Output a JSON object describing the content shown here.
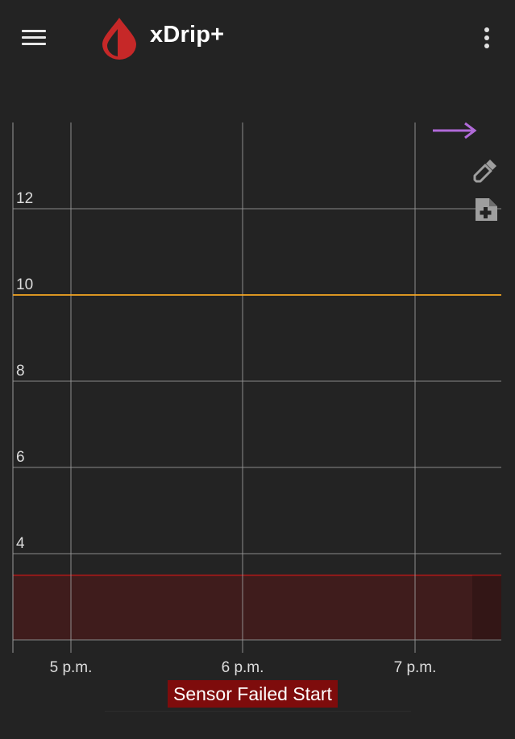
{
  "app": {
    "title": "xDrip+",
    "logo_icon": "droplet-logo-icon",
    "brand_color": "#c62828"
  },
  "toolbar": {
    "menu_icon": "hamburger-menu-icon",
    "overflow_icon": "more-vert-icon"
  },
  "side_actions": [
    {
      "icon": "arrow-right-icon",
      "color": "#b06ad8"
    },
    {
      "icon": "eyedropper-icon",
      "color": "#9e9e9e"
    },
    {
      "icon": "note-add-icon",
      "color": "#9e9e9e"
    }
  ],
  "chart_data": {
    "type": "line",
    "y_tick_labels": [
      "12",
      "10",
      "8",
      "6",
      "4"
    ],
    "x_tick_labels": [
      "5 p.m.",
      "6 p.m.",
      "7 p.m."
    ],
    "ylim": [
      2.0,
      14.0
    ],
    "grid": true,
    "high_line": {
      "value": 10,
      "color": "#f5a623"
    },
    "low_band": {
      "from": 2.0,
      "to": 3.5,
      "color": "#3f1c1c",
      "edge_color": "#b01818"
    },
    "series": []
  },
  "status": {
    "banner_text": "Sensor Failed Start",
    "banner_color": "#7e0c0c"
  }
}
